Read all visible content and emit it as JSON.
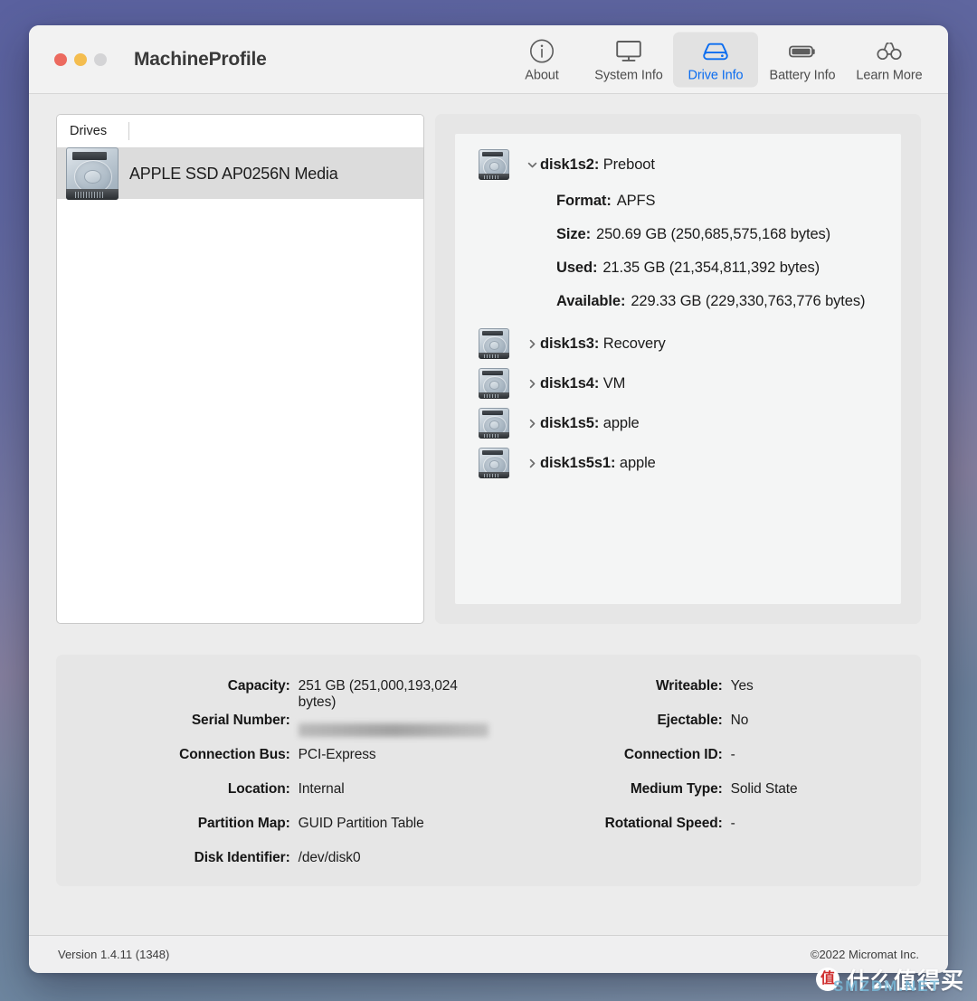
{
  "window": {
    "title": "MachineProfile",
    "traffic_lights": [
      "close",
      "minimize",
      "zoom"
    ]
  },
  "toolbar": {
    "items": [
      {
        "label": "About",
        "icon": "info-circle-icon",
        "active": false
      },
      {
        "label": "System Info",
        "icon": "desktop-icon",
        "active": false
      },
      {
        "label": "Drive Info",
        "icon": "drive-icon",
        "active": true
      },
      {
        "label": "Battery Info",
        "icon": "battery-icon",
        "active": false
      },
      {
        "label": "Learn More",
        "icon": "binoculars-icon",
        "active": false
      }
    ],
    "active_color": "#0a6cf0"
  },
  "drives_panel": {
    "header": "Drives",
    "rows": [
      {
        "label": "APPLE SSD AP0256N Media",
        "icon": "hard-drive-icon",
        "selected": true
      }
    ]
  },
  "detail_panel": {
    "disks": [
      {
        "id": "disk1s2",
        "name": "Preboot",
        "expanded": true,
        "twisty": "chevron-down-icon",
        "fields": [
          {
            "key": "Format:",
            "value": "APFS"
          },
          {
            "key": "Size:",
            "value": "250.69 GB (250,685,575,168 bytes)"
          },
          {
            "key": "Used:",
            "value": "21.35 GB (21,354,811,392 bytes)"
          },
          {
            "key": "Available:",
            "value": "229.33 GB (229,330,763,776 bytes)"
          }
        ]
      },
      {
        "id": "disk1s3",
        "name": "Recovery",
        "expanded": false,
        "twisty": "chevron-right-icon",
        "fields": []
      },
      {
        "id": "disk1s4",
        "name": "VM",
        "expanded": false,
        "twisty": "chevron-right-icon",
        "fields": []
      },
      {
        "id": "disk1s5",
        "name": "apple",
        "expanded": false,
        "twisty": "chevron-right-icon",
        "fields": []
      },
      {
        "id": "disk1s5s1",
        "name": "apple",
        "expanded": false,
        "twisty": "chevron-right-icon",
        "fields": []
      }
    ]
  },
  "info_card": {
    "left": [
      {
        "key": "Capacity:",
        "value": "251 GB (251,000,193,024 bytes)",
        "redacted": false
      },
      {
        "key": "Serial Number:",
        "value": "",
        "redacted": true
      },
      {
        "key": "Connection Bus:",
        "value": "PCI-Express",
        "redacted": false
      },
      {
        "key": "Location:",
        "value": "Internal",
        "redacted": false
      },
      {
        "key": "Partition Map:",
        "value": "GUID Partition Table",
        "redacted": false
      },
      {
        "key": "Disk Identifier:",
        "value": "/dev/disk0",
        "redacted": false
      }
    ],
    "right": [
      {
        "key": "Writeable:",
        "value": "Yes",
        "redacted": false
      },
      {
        "key": "Ejectable:",
        "value": "No",
        "redacted": false
      },
      {
        "key": "Connection ID:",
        "value": "-",
        "redacted": false
      },
      {
        "key": "Medium Type:",
        "value": "Solid State",
        "redacted": false
      },
      {
        "key": "Rotational Speed:",
        "value": "-",
        "redacted": false
      }
    ]
  },
  "footer": {
    "version": "Version 1.4.11 (1348)",
    "copyright": "©2022 Micromat Inc."
  },
  "watermark": {
    "badge": "值",
    "text": "什么值得买",
    "sub": "SMZDM.NET"
  }
}
